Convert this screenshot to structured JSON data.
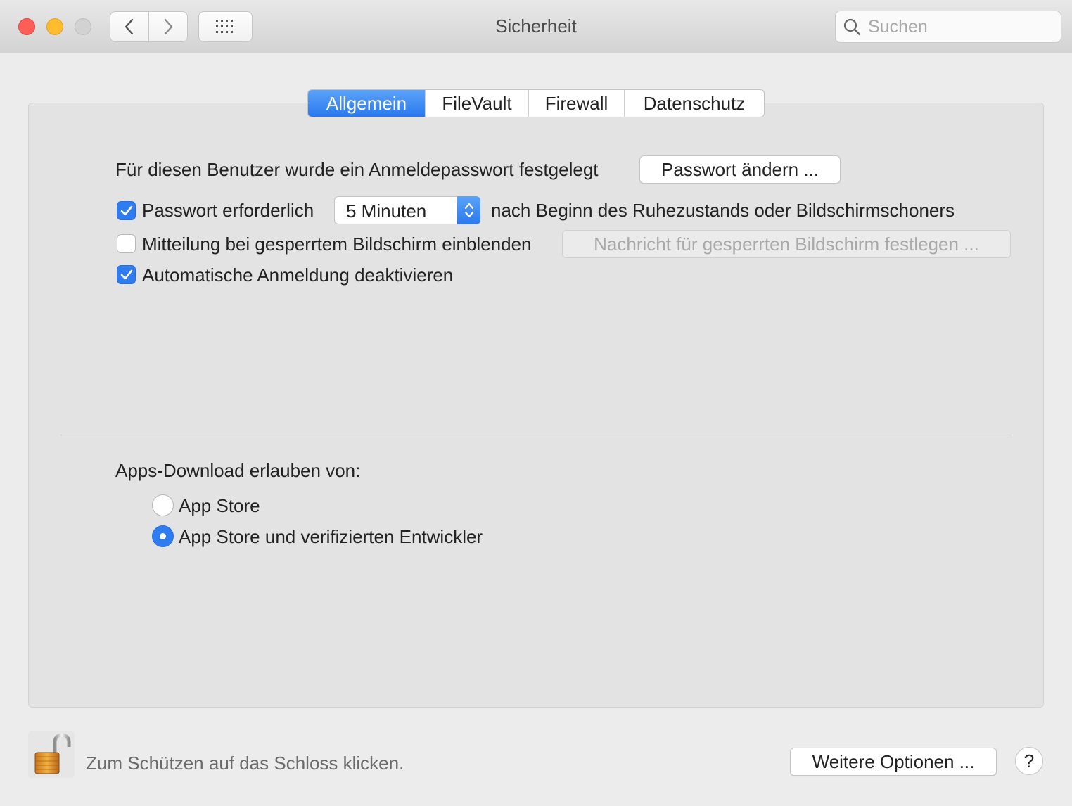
{
  "window": {
    "title": "Sicherheit",
    "search_placeholder": "Suchen"
  },
  "tabs": [
    {
      "label": "Allgemein",
      "active": true
    },
    {
      "label": "FileVault",
      "active": false
    },
    {
      "label": "Firewall",
      "active": false
    },
    {
      "label": "Datenschutz",
      "active": false
    }
  ],
  "general": {
    "password_set_text": "Für diesen Benutzer wurde ein Anmeldepasswort festgelegt",
    "change_password_button": "Passwort ändern ...",
    "require_password": {
      "label": "Passwort erforderlich",
      "checked": true
    },
    "delay_select": {
      "value": "5 Minuten"
    },
    "after_text": "nach Beginn des Ruhezustands oder Bildschirmschoners",
    "show_message": {
      "label": "Mitteilung bei gesperrtem Bildschirm einblenden",
      "checked": false
    },
    "set_message_button": "Nachricht für gesperrten Bildschirm festlegen ...",
    "disable_autologin": {
      "label": "Automatische Anmeldung deaktivieren",
      "checked": true
    }
  },
  "downloads": {
    "heading": "Apps-Download erlauben von:",
    "options": [
      {
        "label": "App Store",
        "selected": false
      },
      {
        "label": "App Store und verifizierten Entwickler",
        "selected": true
      }
    ]
  },
  "footer": {
    "lock_text": "Zum Schützen auf das Schloss klicken.",
    "advanced_button": "Weitere Optionen ...",
    "help_label": "?"
  },
  "colors": {
    "accent": "#2f7cf1",
    "close": "#fd5f57",
    "minimize": "#febc2e",
    "zoom_disabled": "#d2d2d2"
  },
  "icons": [
    "close-icon",
    "minimize-icon",
    "zoom-icon",
    "chevron-left-icon",
    "chevron-right-icon",
    "grid-icon",
    "search-icon",
    "checkmark-icon",
    "lock-open-icon"
  ]
}
